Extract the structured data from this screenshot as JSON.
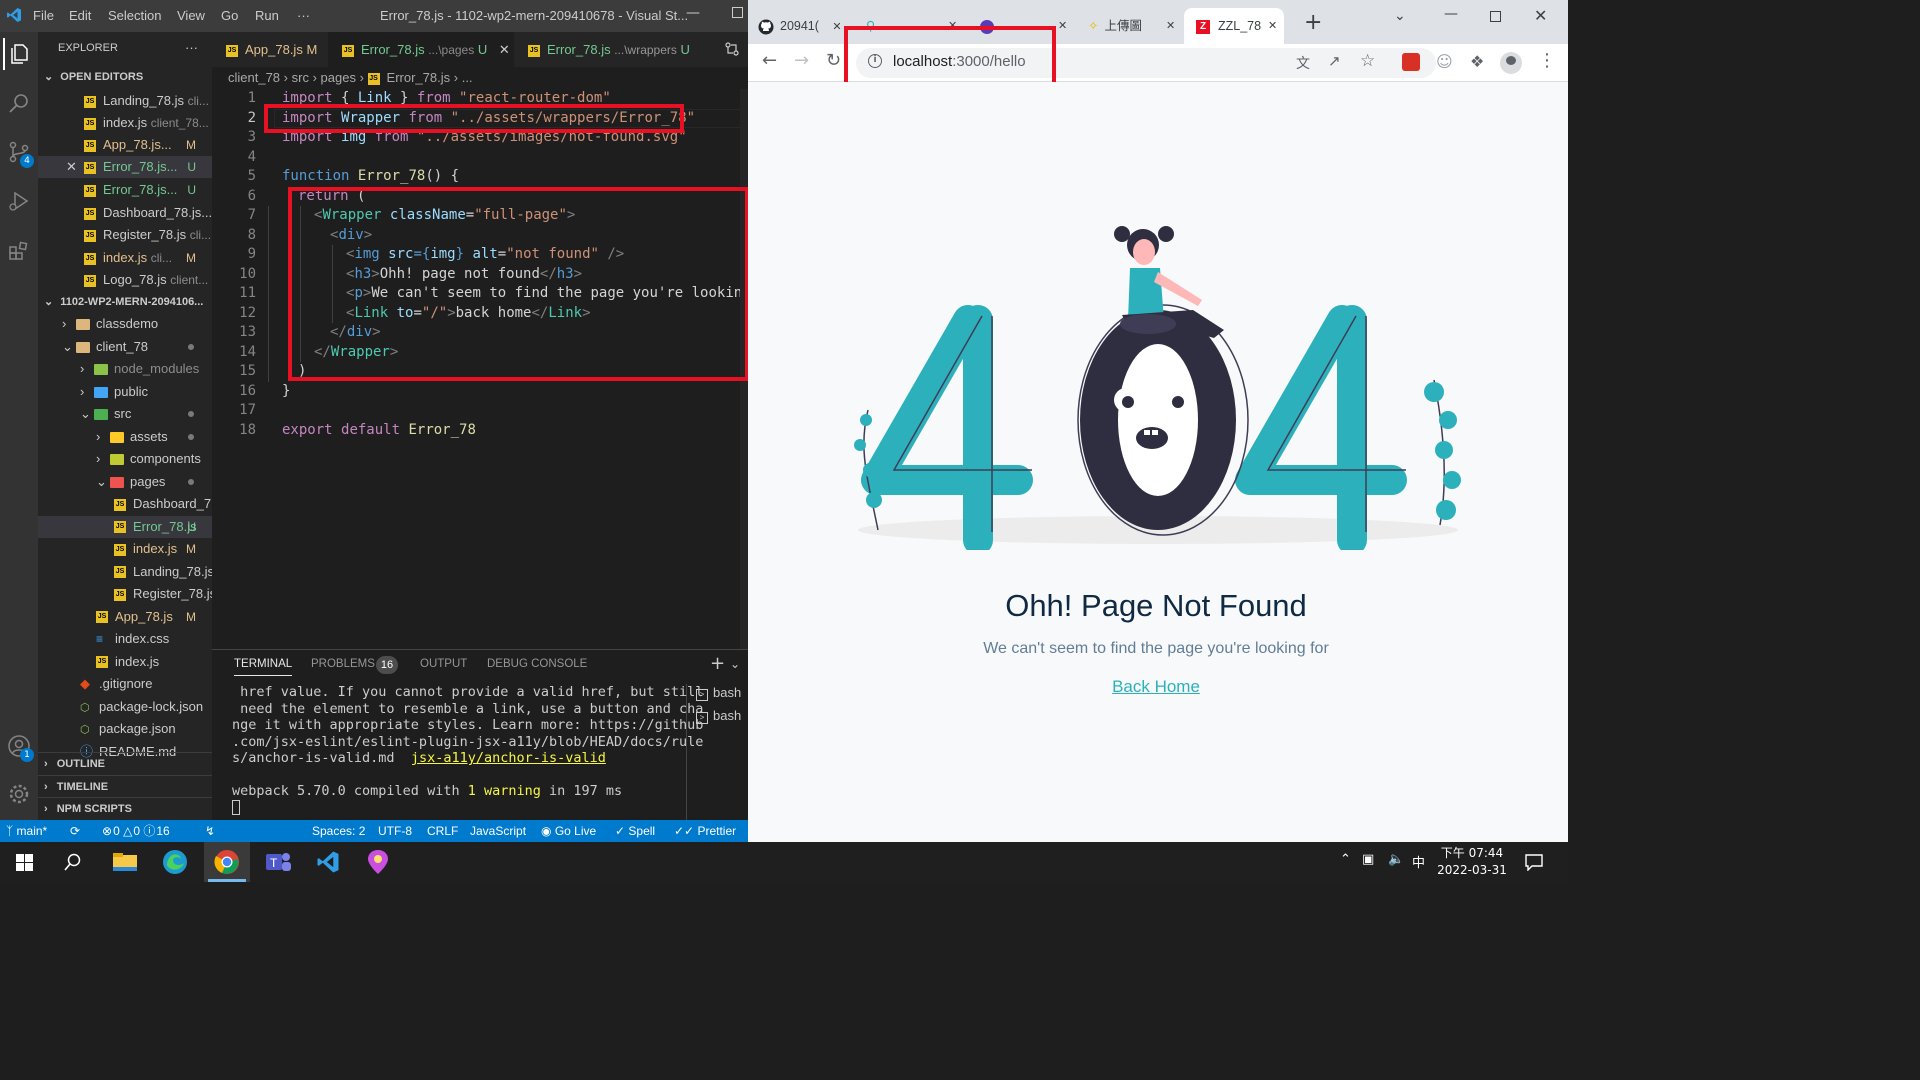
{
  "vscode": {
    "title": "Error_78.js - 1102-wp2-mern-209410678 - Visual St...",
    "menu": [
      "File",
      "Edit",
      "Selection",
      "View",
      "Go",
      "Run",
      "···"
    ],
    "explorer": {
      "header": "EXPLORER",
      "open_editors_label": "OPEN EDITORS",
      "open_editors": [
        {
          "name": "Landing_78.js",
          "hint": "cli...",
          "badge": ""
        },
        {
          "name": "index.js",
          "hint": "client_78...",
          "badge": ""
        },
        {
          "name": "App_78.js...",
          "hint": "",
          "badge": "M"
        },
        {
          "name": "Error_78.js...",
          "hint": "",
          "badge": "U"
        },
        {
          "name": "Error_78.js...",
          "hint": "",
          "badge": "U"
        },
        {
          "name": "Dashboard_78.js...",
          "hint": "",
          "badge": ""
        },
        {
          "name": "Register_78.js",
          "hint": "cli...",
          "badge": ""
        },
        {
          "name": "index.js",
          "hint": "cli...",
          "badge": "M"
        },
        {
          "name": "Logo_78.js",
          "hint": "client...",
          "badge": ""
        }
      ],
      "project_label": "1102-WP2-MERN-2094106...",
      "tree": [
        {
          "name": "classdemo",
          "type": "folder"
        },
        {
          "name": "client_78",
          "type": "folder-open"
        },
        {
          "name": "node_modules",
          "type": "folder"
        },
        {
          "name": "public",
          "type": "folder"
        },
        {
          "name": "src",
          "type": "folder-open"
        },
        {
          "name": "assets",
          "type": "folder"
        },
        {
          "name": "components",
          "type": "folder"
        },
        {
          "name": "pages",
          "type": "folder-open"
        },
        {
          "name": "Dashboard_7...",
          "type": "js"
        },
        {
          "name": "Error_78.js",
          "type": "js",
          "badge": "U"
        },
        {
          "name": "index.js",
          "type": "js",
          "badge": "M"
        },
        {
          "name": "Landing_78.js",
          "type": "js"
        },
        {
          "name": "Register_78.js",
          "type": "js"
        },
        {
          "name": "App_78.js",
          "type": "js",
          "badge": "M"
        },
        {
          "name": "index.css",
          "type": "css"
        },
        {
          "name": "index.js",
          "type": "js"
        },
        {
          "name": ".gitignore",
          "type": "git"
        },
        {
          "name": "package-lock.json",
          "type": "json"
        },
        {
          "name": "package.json",
          "type": "json"
        },
        {
          "name": "README.md",
          "type": "md"
        }
      ],
      "outline_label": "OUTLINE",
      "timeline_label": "TIMELINE",
      "npm_label": "NPM SCRIPTS"
    },
    "tabs": [
      {
        "name": "App_78.js",
        "hint": "",
        "badge": "M"
      },
      {
        "name": "Error_78.js",
        "hint": "...\\pages",
        "badge": "U"
      },
      {
        "name": "Error_78.js",
        "hint": "...\\wrappers",
        "badge": "U"
      }
    ],
    "breadcrumb": [
      "client_78",
      "src",
      "pages",
      "Error_78.js",
      "..."
    ],
    "code_lines": [
      "1",
      "2",
      "3",
      "4",
      "5",
      "6",
      "7",
      "8",
      "9",
      "10",
      "11",
      "12",
      "13",
      "14",
      "15",
      "16",
      "17",
      "18"
    ],
    "code": {
      "l1": [
        "import",
        " { ",
        "Link",
        " } ",
        "from",
        " ",
        "\"react-router-dom\""
      ],
      "l2": [
        "import",
        " ",
        "Wrapper",
        " ",
        "from",
        " ",
        "\"../assets/wrappers/Error_78\""
      ],
      "l3": [
        "import",
        " ",
        "img",
        " ",
        "from",
        " ",
        "\"../assets/images/not-found.svg\""
      ],
      "l5": [
        "function",
        " ",
        "Error_78",
        "() {"
      ],
      "l6": [
        "return",
        " ("
      ],
      "l7": [
        "<",
        "Wrapper",
        " ",
        "className",
        "=",
        "\"full-page\"",
        ">"
      ],
      "l8": [
        "<",
        "div",
        ">"
      ],
      "l9": [
        "<",
        "img",
        " ",
        "src",
        "={",
        "img",
        "} ",
        "alt",
        "=",
        "\"not found\"",
        " />"
      ],
      "l10": [
        "<",
        "h3",
        ">",
        "Ohh! page not found",
        "</",
        "h3",
        ">"
      ],
      "l11": [
        "<",
        "p",
        ">",
        "We can't seem to find the page you're looking f"
      ],
      "l12": [
        "<",
        "Link",
        " ",
        "to",
        "=",
        "\"/\"",
        ">",
        "back home",
        "</",
        "Link",
        ">"
      ],
      "l13": [
        "</",
        "div",
        ">"
      ],
      "l14": [
        "</",
        "Wrapper",
        ">"
      ],
      "l15": [
        ")"
      ],
      "l16": [
        "}"
      ],
      "l18": [
        "export",
        " ",
        "default",
        " ",
        "Error_78"
      ]
    },
    "panel": {
      "tabs": [
        "TERMINAL",
        "PROBLEMS",
        "OUTPUT",
        "DEBUG CONSOLE"
      ],
      "problems_count": "16",
      "terminal_text": " href value. If you cannot provide a valid href, but still\n need the element to resemble a link, use a button and cha\nnge it with appropriate styles. Learn more: https://github\n.com/jsx-eslint/eslint-plugin-jsx-a11y/blob/HEAD/docs/rule\ns/anchor-is-valid.md",
      "terminal_link": "jsx-a11y/anchor-is-valid",
      "compile_prefix": "webpack 5.70.0 compiled with ",
      "compile_warn": "1 warning",
      "compile_suffix": " in 197 ms",
      "shells": [
        "bash",
        "bash"
      ]
    },
    "status": {
      "branch": "main*",
      "errors": "0",
      "warnings": "0",
      "info": "16",
      "spaces": "Spaces: 2",
      "encoding": "UTF-8",
      "eol": "CRLF",
      "language": "JavaScript",
      "golive": "Go Live",
      "spell": "Spell",
      "prettier": "Prettier"
    },
    "accounts_badge": "1",
    "scm_badge": "4"
  },
  "chrome": {
    "tabs": [
      {
        "label": "20941(",
        "icon": "github-icon"
      },
      {
        "label": "",
        "icon": "link-icon"
      },
      {
        "label": "",
        "icon": "circle-icon"
      },
      {
        "label": "上傳圖",
        "icon": "sparkle-icon"
      },
      {
        "label": "ZZL_78",
        "icon": "zzl-icon"
      }
    ],
    "url_host": "localhost",
    "url_rest": ":3000/hello",
    "page": {
      "title": "Ohh! Page Not Found",
      "subtitle": "We can't seem to find the page you're looking for",
      "link": "Back Home",
      "accent": "#2cb1bc"
    }
  },
  "taskbar": {
    "time": "下午 07:44",
    "date": "2022-03-31",
    "ime": "中"
  }
}
